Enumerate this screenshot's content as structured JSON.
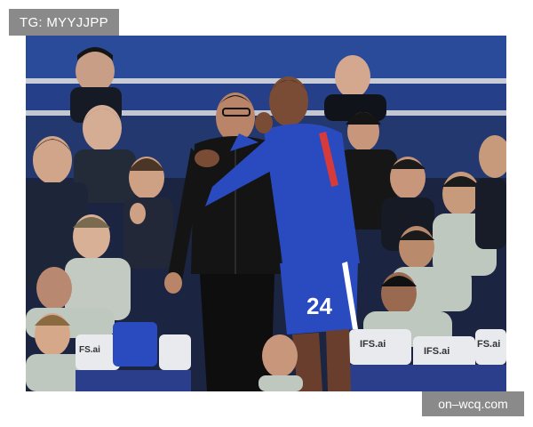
{
  "watermarks": {
    "top_left": "TG: MYYJJPP",
    "bottom_right": "on–wcq.com"
  },
  "photo": {
    "jersey_number": "24",
    "sponsor": "IFS.ai",
    "sponsor_short": "FS.ai",
    "seat_crest_text": "FS.ai"
  },
  "colors": {
    "stand_blue": "#223a7a",
    "kit_blue": "#2a4bc0",
    "jacket_black": "#141414",
    "seat_white": "#e8eaee",
    "jacket_grey": "#bfc8bf"
  }
}
